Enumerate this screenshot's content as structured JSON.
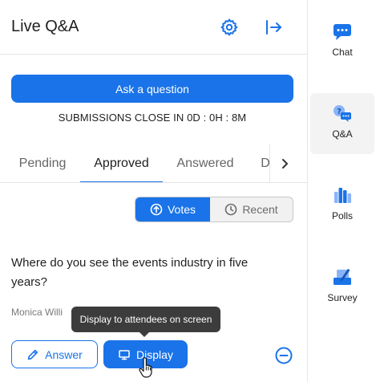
{
  "header": {
    "title": "Live Q&A"
  },
  "ask_button": "Ask a question",
  "deadline": "SUBMISSIONS CLOSE IN 0D : 0H : 8M",
  "tabs": [
    "Pending",
    "Approved",
    "Answered",
    "D"
  ],
  "active_tab": "Approved",
  "sort": {
    "votes": "Votes",
    "recent": "Recent",
    "selected": "Votes"
  },
  "question": {
    "text": "Where do you see the events industry in five years?",
    "author": "Monica Willi"
  },
  "tooltip": "Display to attendees on screen",
  "actions": {
    "answer": "Answer",
    "display": "Display"
  },
  "rail": [
    {
      "label": "Chat",
      "icon": "chat-icon"
    },
    {
      "label": "Q&A",
      "icon": "qa-icon"
    },
    {
      "label": "Polls",
      "icon": "polls-icon"
    },
    {
      "label": "Survey",
      "icon": "survey-icon"
    }
  ],
  "colors": {
    "accent": "#1a73e8",
    "tooltip": "#3c3c3c"
  }
}
